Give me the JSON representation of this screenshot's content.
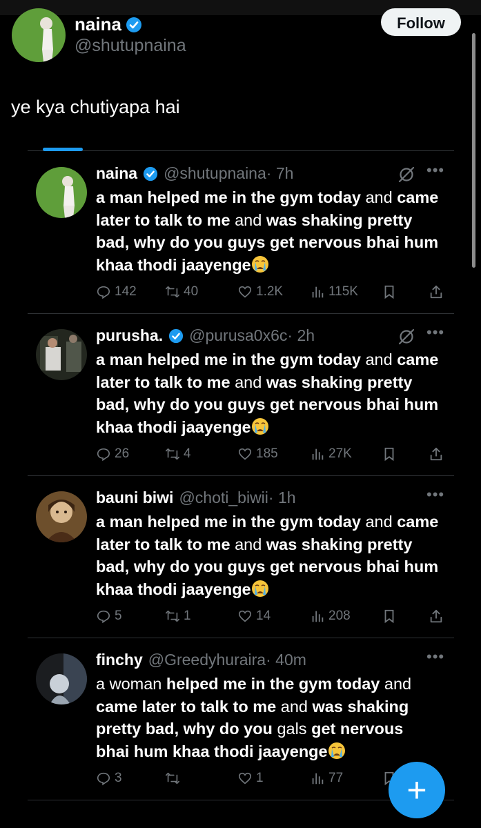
{
  "header": {
    "name": "naina",
    "handle": "@shutupnaina",
    "follow_label": "Follow"
  },
  "quote_text": "ye kya chutiyapa hai",
  "tweets": [
    {
      "name": "naina",
      "verified": true,
      "handle": "@shutupnaina",
      "time": "· 7h",
      "grok": true,
      "body": [
        {
          "text": "a man helped me in the gym today",
          "bold": true
        },
        {
          "text": " and ",
          "bold": false
        },
        {
          "text": "came later to talk to me",
          "bold": true
        },
        {
          "text": " and ",
          "bold": false
        },
        {
          "text": "was shaking pretty bad, why do you guys get nervous bhai hum khaa thodi jaayenge",
          "bold": true
        }
      ],
      "replies": "142",
      "reposts": "40",
      "likes": "1.2K",
      "views": "115K"
    },
    {
      "name": "purusha.",
      "verified": true,
      "handle": "@purusa0x6c",
      "time": "· 2h",
      "grok": true,
      "body": [
        {
          "text": "a man helped me in the gym today",
          "bold": true
        },
        {
          "text": " and ",
          "bold": false
        },
        {
          "text": "came later to talk to me",
          "bold": true
        },
        {
          "text": " and ",
          "bold": false
        },
        {
          "text": "was shaking pretty bad, why do you guys get nervous bhai hum khaa thodi jaayenge",
          "bold": true
        }
      ],
      "replies": "26",
      "reposts": "4",
      "likes": "185",
      "views": "27K"
    },
    {
      "name": "bauni biwi",
      "verified": false,
      "handle": "@choti_biwii",
      "time": "· 1h",
      "grok": false,
      "body": [
        {
          "text": "a man helped me in the gym today",
          "bold": true
        },
        {
          "text": " and ",
          "bold": false
        },
        {
          "text": "came later to talk to me",
          "bold": true
        },
        {
          "text": " and ",
          "bold": false
        },
        {
          "text": "was shaking pretty bad, why do you guys get nervous bhai hum khaa thodi jaayenge",
          "bold": true
        }
      ],
      "replies": "5",
      "reposts": "1",
      "likes": "14",
      "views": "208"
    },
    {
      "name": "finchy",
      "verified": false,
      "handle": "@Greedyhuraira",
      "time": "· 40m",
      "grok": false,
      "body": [
        {
          "text": "a woman",
          "bold": false
        },
        {
          "text": " helped me in the gym today",
          "bold": true
        },
        {
          "text": " and ",
          "bold": false
        },
        {
          "text": "came later to talk to me",
          "bold": true
        },
        {
          "text": " and ",
          "bold": false
        },
        {
          "text": "was shaking pretty bad, why do you",
          "bold": true
        },
        {
          "text": " gals ",
          "bold": false
        },
        {
          "text": "get nervous bhai hum khaa thodi jaayenge",
          "bold": true
        }
      ],
      "replies": "3",
      "reposts": "",
      "likes": "1",
      "views": "77"
    }
  ],
  "fab_label": "+",
  "colors": {
    "background": "#000000",
    "accent": "#1d9bf0",
    "muted": "#71767b",
    "divider": "#2f3336"
  },
  "icons": {
    "verified": "verified-badge-icon",
    "grok": "grok-icon",
    "more": "more-icon",
    "reply": "reply-icon",
    "repost": "repost-icon",
    "like": "like-icon",
    "views": "views-icon",
    "bookmark": "bookmark-icon",
    "share": "share-icon",
    "emoji": "crying-emoji-icon"
  }
}
